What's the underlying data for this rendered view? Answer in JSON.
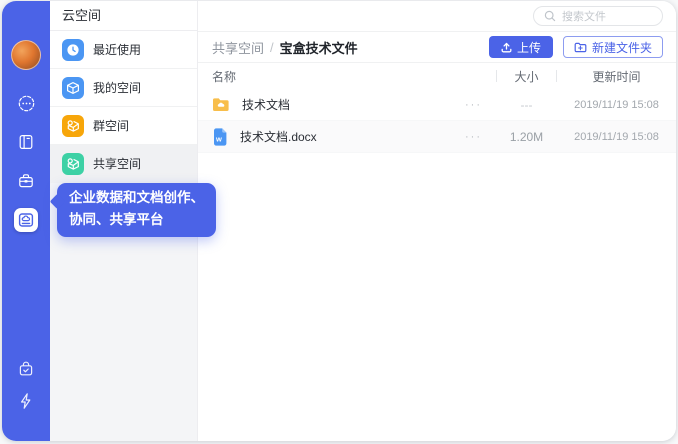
{
  "sidebar": {
    "title": "云空间",
    "items": [
      {
        "label": "最近使用",
        "icon": "clock-icon",
        "color": "#4B96F3",
        "selected": false
      },
      {
        "label": "我的空间",
        "icon": "cube-icon",
        "color": "#4B96F3",
        "selected": false
      },
      {
        "label": "群空间",
        "icon": "group-space-icon",
        "color": "#F7A60A",
        "selected": false
      },
      {
        "label": "共享空间",
        "icon": "share-space-icon",
        "color": "#3DD1A5",
        "selected": true
      }
    ]
  },
  "left_rail": {
    "icons": [
      "avatar",
      "chat-icon",
      "notebook-icon",
      "briefcase-icon",
      "cloud-drive-icon",
      "bag-check-icon",
      "lightning-icon"
    ],
    "selected_icon": "cloud-drive-icon"
  },
  "tooltip": {
    "line1": "企业数据和文档创作、",
    "line2": "协同、共享平台"
  },
  "main": {
    "search": {
      "placeholder": "搜索文件",
      "icon": "search-icon"
    },
    "breadcrumb": {
      "parent": "共享空间",
      "separator": "/",
      "current": "宝盒技术文件"
    },
    "actions": {
      "upload_label": "上传",
      "upload_icon": "upload-icon",
      "new_folder_label": "新建文件夹",
      "new_folder_icon": "folder-plus-icon"
    },
    "table": {
      "columns": [
        "名称",
        "大小",
        "更新时间"
      ],
      "rows": [
        {
          "type": "folder",
          "icon": "folder-icon",
          "name": "技术文档",
          "more": "···",
          "size": "---",
          "updated": "2019/11/19 15:08"
        },
        {
          "type": "word",
          "icon": "word-doc-icon",
          "name": "技术文档.docx",
          "more": "···",
          "size": "1.20M",
          "updated": "2019/11/19 15:08"
        }
      ]
    }
  },
  "colors": {
    "primary_blue": "#4B63E7",
    "item_blue": "#4B96F3",
    "item_orange": "#F7A60A",
    "item_teal": "#3DD1A5",
    "folder_yellow": "#F8BE4B",
    "word_blue": "#4B96F3",
    "panel_gray": "#F4F5F7"
  }
}
